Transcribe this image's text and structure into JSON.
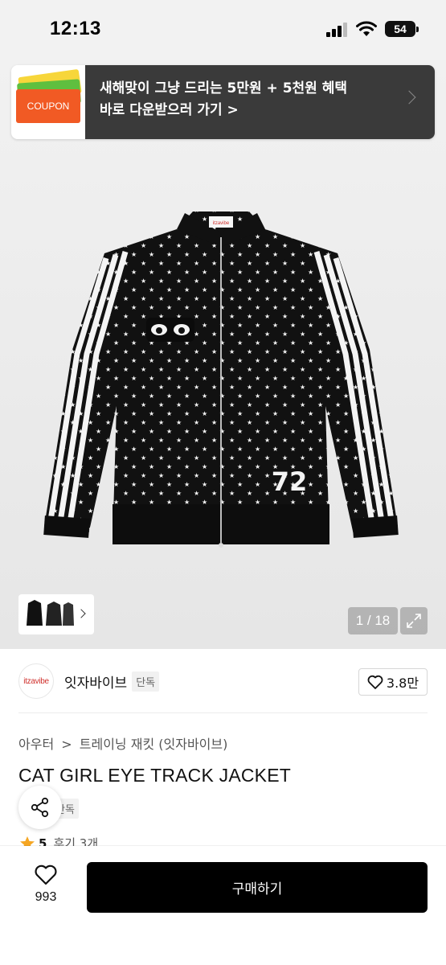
{
  "status_bar": {
    "time": "12:13",
    "battery": "54"
  },
  "coupon_banner": {
    "icon_label": "COUPON",
    "line1": "새해맞이 그냥 드리는 5만원 + 5천원 혜택",
    "line2": "바로 다운받으러 가기 >"
  },
  "gallery": {
    "page_counter": "1 / 18",
    "current_page": 1,
    "total_pages": 18,
    "jersey_number": "72",
    "collar_tag": "itzavibe"
  },
  "brand": {
    "logo_text": "itzavibe",
    "name": "잇자바이브",
    "badge": "단독",
    "likes": "3.8만"
  },
  "breadcrumb": [
    "아우터",
    ">",
    "트레이닝 재킷 (잇자바이브)"
  ],
  "product": {
    "title": "CAT GIRL EYE TRACK JACKET",
    "exclusive_badge": "단독",
    "rating": "5",
    "reviews": "후기 3개"
  },
  "bottom_bar": {
    "wishlist_count": "993",
    "buy_label": "구매하기"
  },
  "colors": {
    "coupon_bg": "#3a3a3a",
    "coupon_orange": "#f15a24",
    "buy_button": "#000000",
    "star": "#f5a623"
  }
}
